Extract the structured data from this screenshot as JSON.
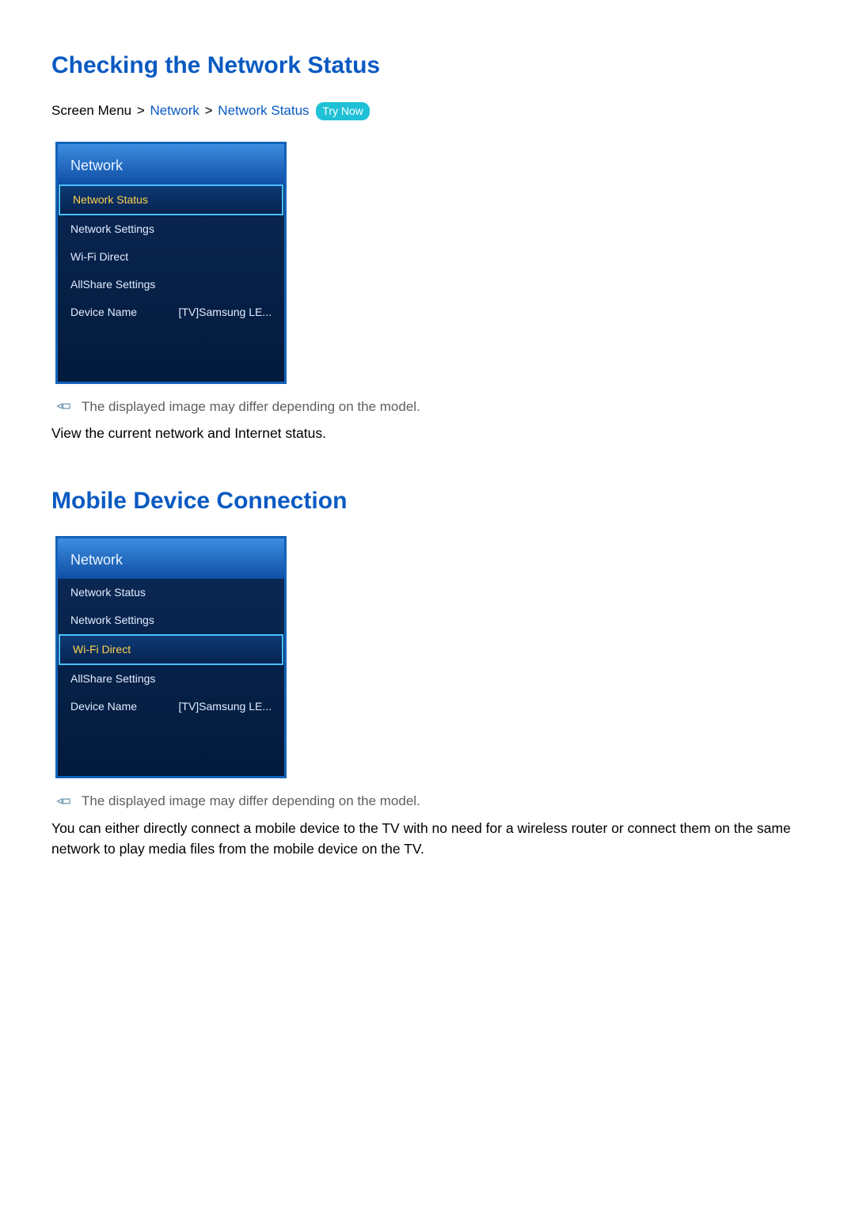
{
  "section1": {
    "title": "Checking the Network Status",
    "breadcrumb": {
      "prefix": "Screen Menu",
      "link1": "Network",
      "link2": "Network Status",
      "try_now": "Try Now"
    },
    "menu": {
      "header": "Network",
      "items": [
        {
          "label": "Network Status",
          "value": "",
          "selected": true
        },
        {
          "label": "Network Settings",
          "value": "",
          "selected": false
        },
        {
          "label": "Wi-Fi Direct",
          "value": "",
          "selected": false
        },
        {
          "label": "AllShare Settings",
          "value": "",
          "selected": false
        },
        {
          "label": "Device Name",
          "value": "[TV]Samsung LE...",
          "selected": false
        }
      ]
    },
    "note": "The displayed image may differ depending on the model.",
    "body": "View the current network and Internet status."
  },
  "section2": {
    "title": "Mobile Device Connection",
    "menu": {
      "header": "Network",
      "items": [
        {
          "label": "Network Status",
          "value": "",
          "selected": false
        },
        {
          "label": "Network Settings",
          "value": "",
          "selected": false
        },
        {
          "label": "Wi-Fi Direct",
          "value": "",
          "selected": true
        },
        {
          "label": "AllShare Settings",
          "value": "",
          "selected": false
        },
        {
          "label": "Device Name",
          "value": "[TV]Samsung LE...",
          "selected": false
        }
      ]
    },
    "note": "The displayed image may differ depending on the model.",
    "body": "You can either directly connect a mobile device to the TV with no need for a wireless router or connect them on the same network to play media files from the mobile device on the TV."
  }
}
